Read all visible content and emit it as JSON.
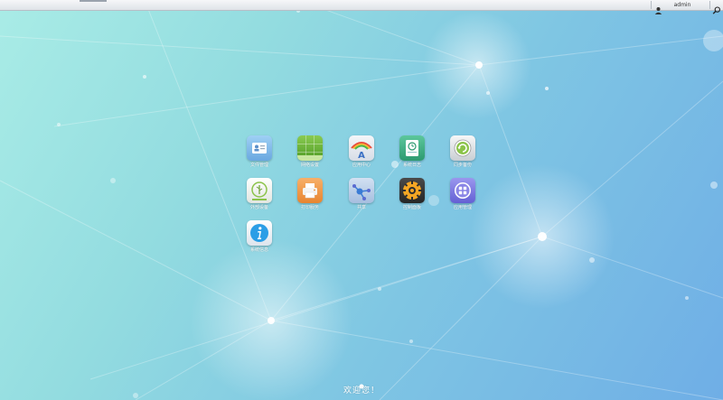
{
  "topbar": {
    "user_icon": "user-icon",
    "username": "admin",
    "search_icon": "search-icon"
  },
  "desktop": {
    "apps": [
      {
        "id": "file-manager",
        "label": "文件管理",
        "icon": "id-card-icon",
        "color": "#7fb8e8"
      },
      {
        "id": "network-settings",
        "label": "网络设置",
        "icon": "grid-icon",
        "color": "#6fb33a"
      },
      {
        "id": "app-store",
        "label": "应用中心",
        "icon": "rainbow-a-icon",
        "color": "#e8ecf2"
      },
      {
        "id": "system-log",
        "label": "系统日志",
        "icon": "clock-book-icon",
        "color": "#3fae84"
      },
      {
        "id": "sync-backup",
        "label": "同步备份",
        "icon": "sync-icon",
        "color": "#e6e8ea"
      },
      {
        "id": "usb-device",
        "label": "外部设备",
        "icon": "usb-icon",
        "color": "#f2f4f0"
      },
      {
        "id": "printer",
        "label": "打印服务",
        "icon": "printer-icon",
        "color": "#f29a4a"
      },
      {
        "id": "share",
        "label": "共享",
        "icon": "share-node-icon",
        "color": "#b9cde6"
      },
      {
        "id": "control-panel",
        "label": "控制面板",
        "icon": "gear-icon",
        "color": "#3a3a3a"
      },
      {
        "id": "app-manager",
        "label": "应用管理",
        "icon": "apps-circle-icon",
        "color": "#7b79e0"
      },
      {
        "id": "system-info",
        "label": "系统信息",
        "icon": "info-icon",
        "color": "#eef2f6"
      }
    ],
    "welcome": "欢迎您！"
  }
}
